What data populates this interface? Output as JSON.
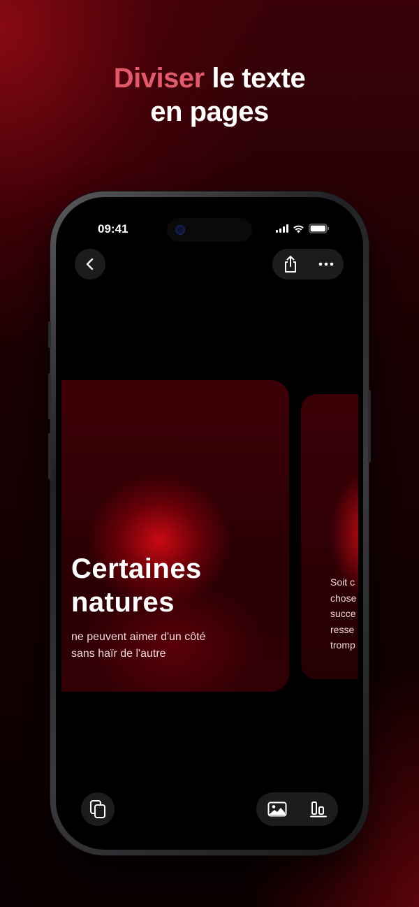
{
  "headline": {
    "accent": "Diviser",
    "line1_rest": " le texte",
    "line2": "en pages"
  },
  "status_bar": {
    "time": "09:41"
  },
  "icons": {
    "back": "chevron-left-icon",
    "share": "share-icon",
    "more": "ellipsis-icon",
    "pages": "copy-pages-icon",
    "image": "image-icon",
    "align": "align-bottom-icon"
  },
  "card": {
    "title_line1": "Certaines",
    "title_line2": "natures",
    "subtitle_line1": "ne peuvent aimer d'un côté",
    "subtitle_line2": "sans haïr de l'autre"
  },
  "next_card": {
    "lines": [
      "Soit c",
      "chose",
      "succe",
      "resse",
      "tromp"
    ]
  },
  "colors": {
    "accent": "#e05a6a",
    "card_red": "#c8101e",
    "button_bg": "#1c1c1e"
  }
}
